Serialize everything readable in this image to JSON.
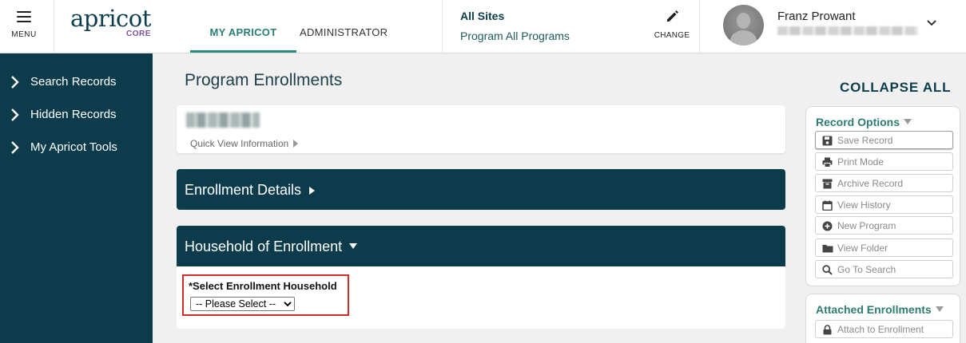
{
  "header": {
    "menu_label": "MENU",
    "logo_word": "apricot",
    "logo_sub": "CORE",
    "tabs": [
      {
        "label": "MY APRICOT",
        "active": true
      },
      {
        "label": "ADMINISTRATOR",
        "active": false
      }
    ],
    "sites_label": "All Sites",
    "program_label": "Program All Programs",
    "change_label": "CHANGE",
    "user_name": "Franz Prowant"
  },
  "sidebar": {
    "items": [
      {
        "label": "Search Records"
      },
      {
        "label": "Hidden Records"
      },
      {
        "label": "My Apricot Tools"
      }
    ]
  },
  "main": {
    "title": "Program Enrollments",
    "quick_view_label": "Quick View Information",
    "enrollment_details": "Enrollment Details",
    "household_title": "Household of Enrollment",
    "household_field_label": "*Select Enrollment Household",
    "household_select_value": "-- Please Select --"
  },
  "right": {
    "collapse_all": "COLLAPSE ALL",
    "record_options_title": "Record Options",
    "options": [
      {
        "label": "Save Record",
        "icon": "save-icon"
      },
      {
        "label": "Print Mode",
        "icon": "print-icon"
      },
      {
        "label": "Archive Record",
        "icon": "archive-icon"
      },
      {
        "label": "View History",
        "icon": "calendar-icon"
      },
      {
        "label": "New Program",
        "icon": "plus-circle-icon"
      },
      {
        "label": "View Folder",
        "icon": "folder-icon"
      },
      {
        "label": "Go To Search",
        "icon": "search-icon"
      }
    ],
    "attached_title": "Attached Enrollments",
    "attach_button": "Attach to Enrollment"
  },
  "colors": {
    "teal_dark": "#0c3c4c",
    "teal_accent": "#2a8b7e",
    "highlight_red": "#d42a2a"
  }
}
